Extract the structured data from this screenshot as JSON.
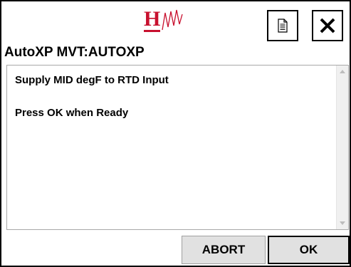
{
  "header": {
    "logo_text": "H",
    "doc_icon": "document-icon",
    "close_icon": "close-icon"
  },
  "title": "AutoXP MVT:AUTOXP",
  "message": {
    "line1": "Supply MID degF to RTD Input",
    "line2": "Press OK when Ready"
  },
  "buttons": {
    "abort_label": "ABORT",
    "ok_label": "OK"
  },
  "colors": {
    "logo_red": "#c8102e",
    "button_bg": "#e1e1e1"
  }
}
